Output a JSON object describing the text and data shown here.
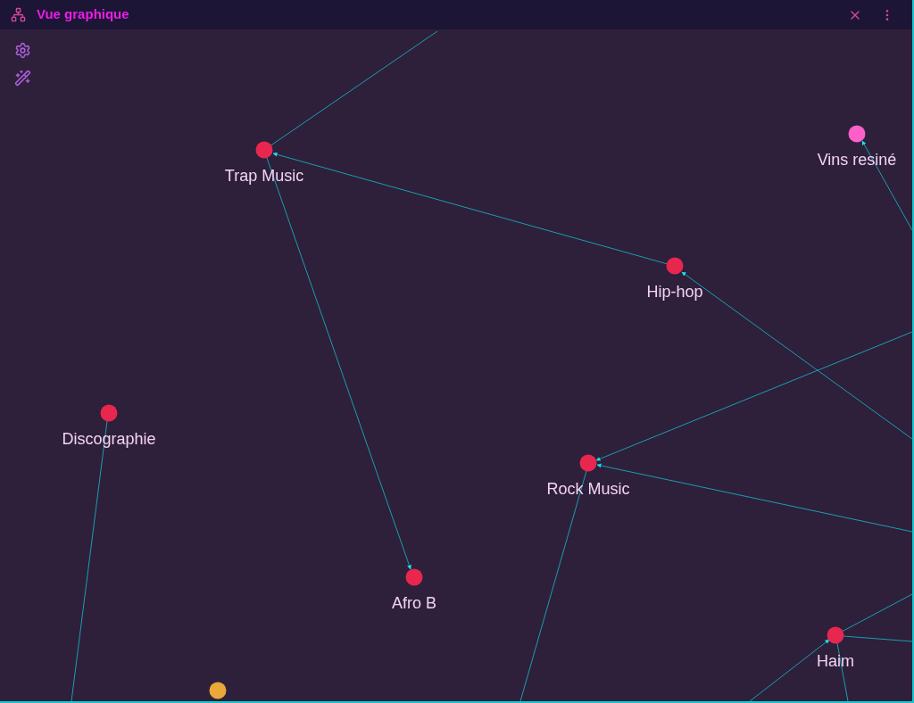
{
  "window": {
    "title": "Vue graphique"
  },
  "graph": {
    "nodes": [
      {
        "label": "Trap Music",
        "color": "#e8274f"
      },
      {
        "label": "Vins resiné",
        "color": "#ff5fc8"
      },
      {
        "label": "Hip-hop",
        "color": "#e8274f"
      },
      {
        "label": "Discographie",
        "color": "#e8274f"
      },
      {
        "label": "Rock Music",
        "color": "#e8274f"
      },
      {
        "label": "Afro B",
        "color": "#e8274f"
      },
      {
        "label": "Haim",
        "color": "#e8274f"
      },
      {
        "color": "#e8a83a"
      }
    ]
  }
}
